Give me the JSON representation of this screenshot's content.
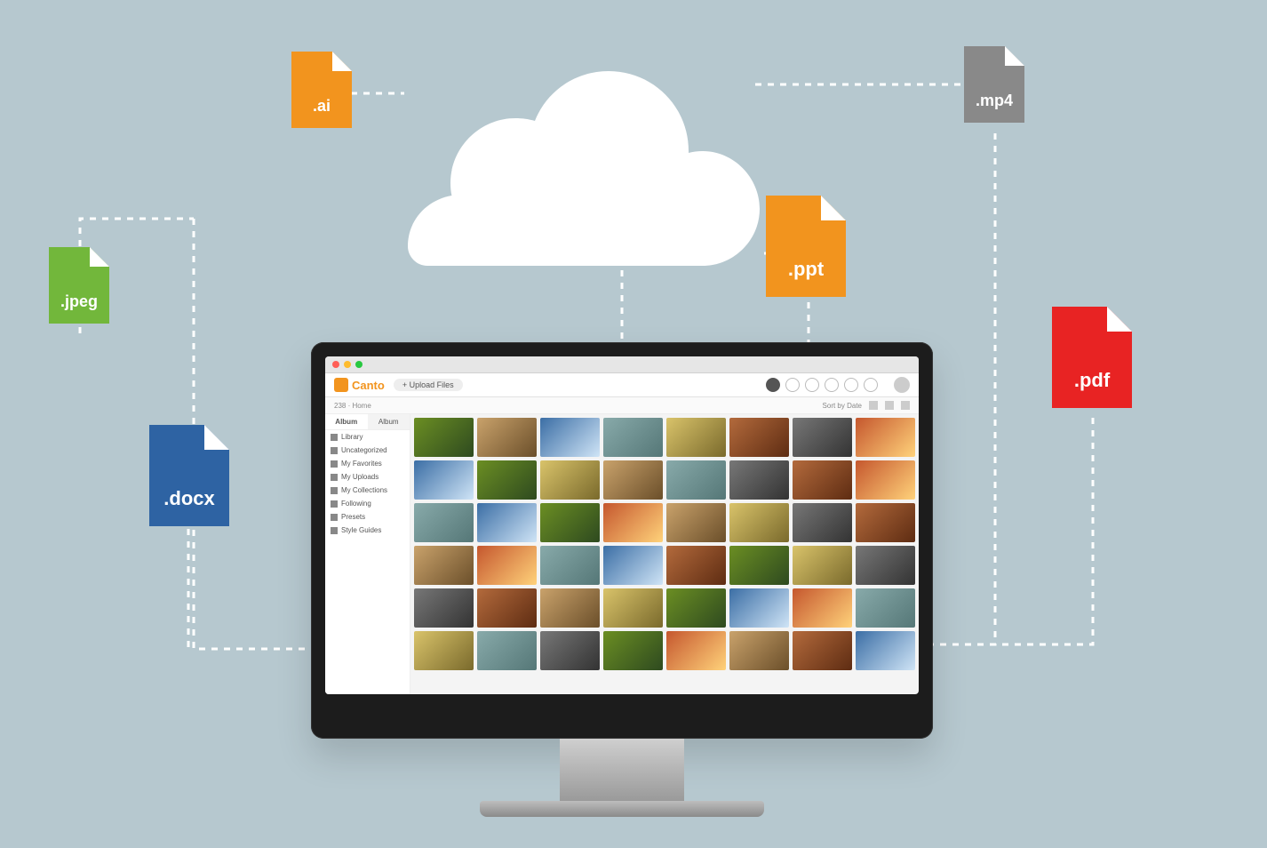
{
  "file_icons": {
    "ai": {
      "label": ".ai"
    },
    "mp4": {
      "label": ".mp4"
    },
    "jpeg": {
      "label": ".jpeg"
    },
    "ppt": {
      "label": ".ppt"
    },
    "docx": {
      "label": ".docx"
    },
    "pdf": {
      "label": ".pdf"
    }
  },
  "app": {
    "brand": "Canto",
    "upload_label": "+ Upload Files",
    "breadcrumb": "238 · Home",
    "sort_label": "Sort by Date",
    "sidebar": {
      "tabs": [
        "Album",
        "Album"
      ],
      "items": [
        "Library",
        "Uncategorized",
        "My Favorites",
        "My Uploads",
        "My Collections",
        "Following",
        "Presets",
        "Style Guides"
      ]
    }
  }
}
